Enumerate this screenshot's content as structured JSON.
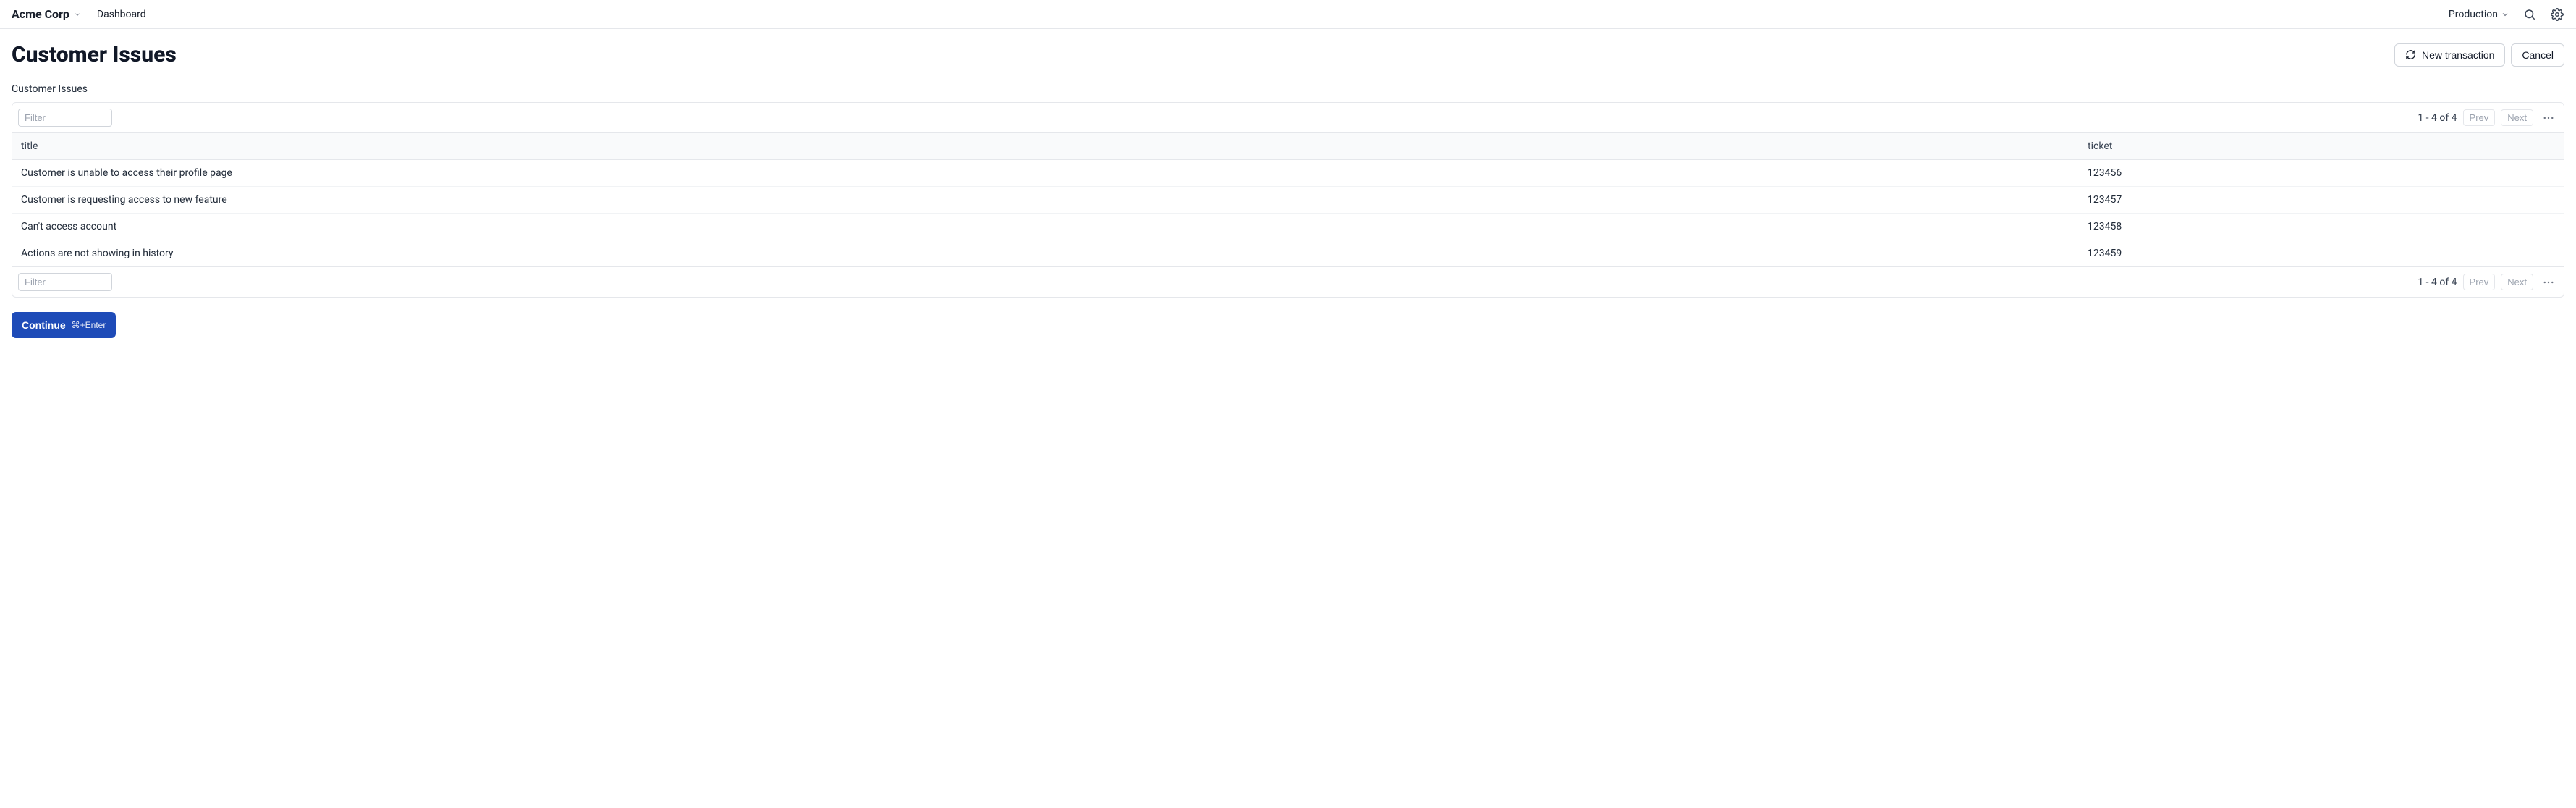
{
  "header": {
    "org": "Acme Corp",
    "nav": "Dashboard",
    "env": "Production"
  },
  "page": {
    "title": "Customer Issues",
    "new_transaction": "New transaction",
    "cancel": "Cancel",
    "section_label": "Customer Issues"
  },
  "table": {
    "filter_placeholder": "Filter",
    "range": "1 - 4 of 4",
    "prev": "Prev",
    "next": "Next",
    "columns": {
      "title": "title",
      "ticket": "ticket"
    },
    "rows": [
      {
        "title": "Customer is unable to access their profile page",
        "ticket": "123456"
      },
      {
        "title": "Customer is requesting access to new feature",
        "ticket": "123457"
      },
      {
        "title": "Can't access account",
        "ticket": "123458"
      },
      {
        "title": "Actions are not showing in history",
        "ticket": "123459"
      }
    ]
  },
  "footer": {
    "continue": "Continue",
    "shortcut": "⌘+Enter"
  }
}
